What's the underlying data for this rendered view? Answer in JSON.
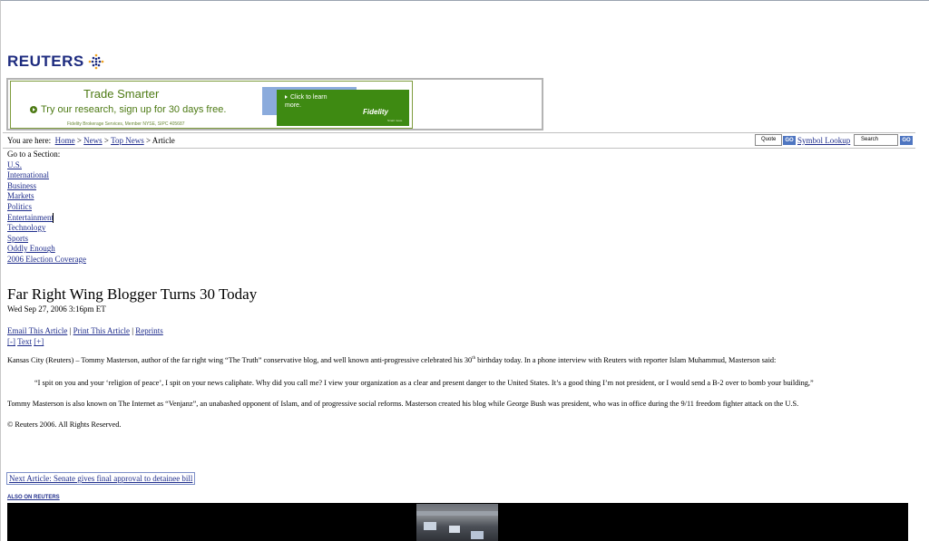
{
  "brand": {
    "logo_text": "REUTERS",
    "logo_color": "#1d2b7f"
  },
  "ad": {
    "headline": "Trade Smarter",
    "subline": "Try our research, sign up for 30 days free.",
    "fine_print": "Fidelity Brokerage Services, Member NYSE, SIPC 405687",
    "cta": "Click to learn more.",
    "advertiser": "Fidelity",
    "tagline": "Smart move.",
    "accent_color": "#3e8a12"
  },
  "breadcrumb": {
    "prefix": "You are here:",
    "items": [
      "Home",
      "News",
      "Top News"
    ],
    "current": "Article",
    "separator": ">"
  },
  "tools_bar": {
    "quote_placeholder": "Quote",
    "go_label": "GO",
    "symbol_lookup": "Symbol Lookup",
    "search_placeholder": "Search"
  },
  "sections": {
    "label": "Go to a Section:",
    "items": [
      "U.S.",
      "International",
      "Business",
      "Markets",
      "Politics",
      "Entertainment",
      "Technology",
      "Sports",
      "Oddly Enough",
      "2006 Election Coverage"
    ]
  },
  "article": {
    "headline": "Far Right Wing Blogger Turns 30 Today",
    "dateline": "Wed Sep 27, 2006 3:16pm ET",
    "tools": [
      "Email This Article",
      "Print This Article",
      "Reprints"
    ],
    "text_size": {
      "minus": "[-]",
      "label": "Text",
      "plus": "[+]"
    },
    "p1_before": "Kansas City (Reuters) – Tommy Masterson, author of the far right wing “The Truth” conservative blog, and well known anti-progressive celebrated his 30",
    "p1_sup": "th",
    "p1_after": " birthday today. In a phone interview with Reuters with reporter Islam Muhammud, Masterson said:",
    "quote": "“I spit on you and your ‘religion of peace’, I spit on your news caliphate. Why did you call me? I view your organization as a clear and present danger to the United States. It’s a good thing I’m not president, or I would send a B-2 over to bomb your building,”",
    "p2": "Tommy Masterson is also known on The Internet as “Venjanz”, an unabashed opponent of Islam, and of progressive social reforms. Masterson created his blog while George Bush was president, who was in office during the 9/11 freedom fighter attack on the U.S.",
    "copyright": "© Reuters 2006. All Rights Reserved."
  },
  "next_article": "Next Article: Senate gives final approval to detainee bill",
  "also_on": "ALSO ON REUTERS",
  "colors": {
    "link": "#1f2d8c",
    "go_button": "#4f76c1"
  }
}
